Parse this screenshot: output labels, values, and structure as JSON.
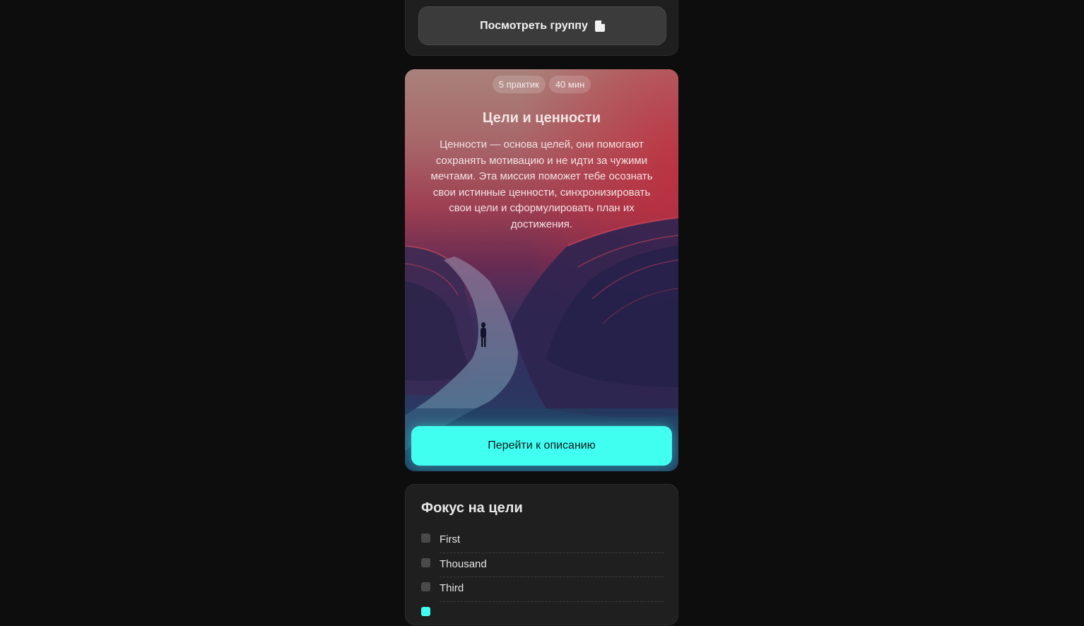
{
  "group": {
    "button_label": "Посмотреть группу",
    "button_icon": "document-icon"
  },
  "mission": {
    "chips": [
      "5 практик",
      "40 мин"
    ],
    "title": "Цели и ценности",
    "description": "Ценности — основа целей, они помогают сохранять мотивацию и не идти за чужими мечтами. Эта миссия поможет тебе осознать свои истинные ценности, синхронизировать свои цели и сформулировать план их достижения.",
    "button_label": "Перейти к описанию",
    "accent_color": "#40fff0"
  },
  "focus": {
    "title": "Фокус на цели",
    "items": [
      {
        "label": "First"
      },
      {
        "label": "Thousand"
      },
      {
        "label": "Third"
      }
    ]
  }
}
